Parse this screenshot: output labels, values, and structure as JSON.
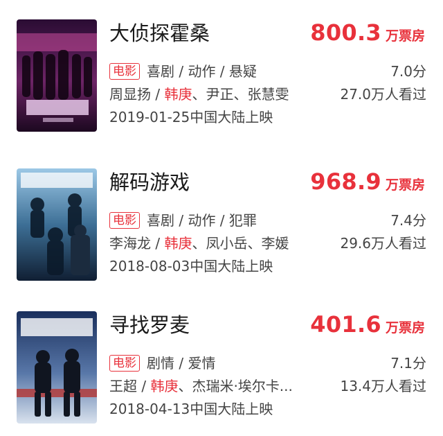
{
  "movies": [
    {
      "title": "大侦探霍桑",
      "box_value": "800.3",
      "box_unit": "万票房",
      "tag": "电影",
      "genres": "喜剧 / 动作 / 悬疑",
      "score": "7.0分",
      "cast_before": "周显扬 / ",
      "cast_highlight": "韩庚",
      "cast_after": "、尹正、张慧雯",
      "watchers": "27.0万人看过",
      "release": "2019-01-25中国大陆上映",
      "poster_colors": [
        "#3a1045",
        "#7b2a6e",
        "#c25a9a"
      ]
    },
    {
      "title": "解码游戏",
      "box_value": "968.9",
      "box_unit": "万票房",
      "tag": "电影",
      "genres": "喜剧 / 动作 / 犯罪",
      "score": "7.4分",
      "cast_before": "李海龙 / ",
      "cast_highlight": "韩庚",
      "cast_after": "、凤小岳、李媛",
      "watchers": "29.6万人看过",
      "release": "2018-08-03中国大陆上映",
      "poster_colors": [
        "#0f2a44",
        "#2f6a8f",
        "#7fb3d5"
      ]
    },
    {
      "title": "寻找罗麦",
      "box_value": "401.6",
      "box_unit": "万票房",
      "tag": "电影",
      "genres": "剧情 / 爱情",
      "score": "7.1分",
      "cast_before": "王超 / ",
      "cast_highlight": "韩庚",
      "cast_after": "、杰瑞米·埃尔卡...",
      "watchers": "13.4万人看过",
      "release": "2018-04-13中国大陆上映",
      "poster_colors": [
        "#1b2e55",
        "#4a6fa5",
        "#c7d3e6"
      ]
    }
  ]
}
